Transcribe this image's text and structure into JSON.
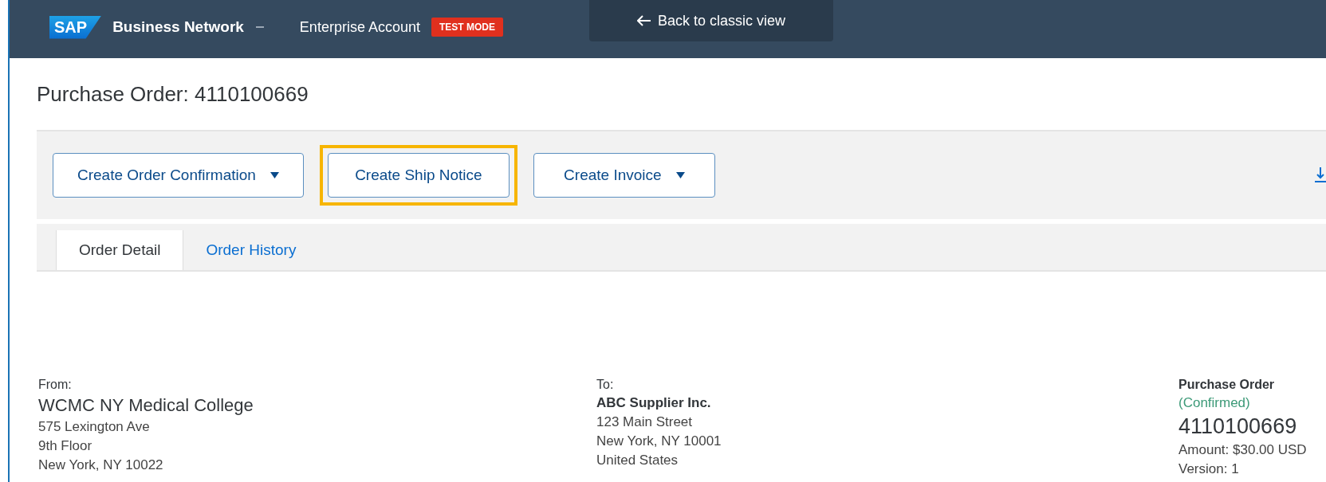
{
  "header": {
    "logo": "SAP",
    "product": "Business Network",
    "account": "Enterprise Account",
    "badge": "TEST MODE",
    "back_button": "Back to classic view"
  },
  "page_title": "Purchase Order: 4110100669",
  "actions": [
    {
      "label": "Create Order Confirmation",
      "dropdown": true,
      "highlighted": false
    },
    {
      "label": "Create Ship Notice",
      "dropdown": false,
      "highlighted": true
    },
    {
      "label": "Create Invoice",
      "dropdown": true,
      "highlighted": false
    }
  ],
  "tabs": [
    {
      "label": "Order Detail",
      "selected": true
    },
    {
      "label": "Order History",
      "selected": false
    }
  ],
  "from": {
    "label": "From:",
    "name": "WCMC NY Medical College",
    "lines": [
      "575 Lexington Ave",
      "9th Floor",
      "New York, NY 10022"
    ]
  },
  "to": {
    "label": "To:",
    "name": "ABC Supplier Inc.",
    "lines": [
      "123 Main Street",
      "New York, NY 10001",
      "United States"
    ]
  },
  "order": {
    "label": "Purchase Order",
    "status": "(Confirmed)",
    "number": "4110100669",
    "lines": [
      "Amount: $30.00 USD",
      "Version: 1"
    ]
  }
}
